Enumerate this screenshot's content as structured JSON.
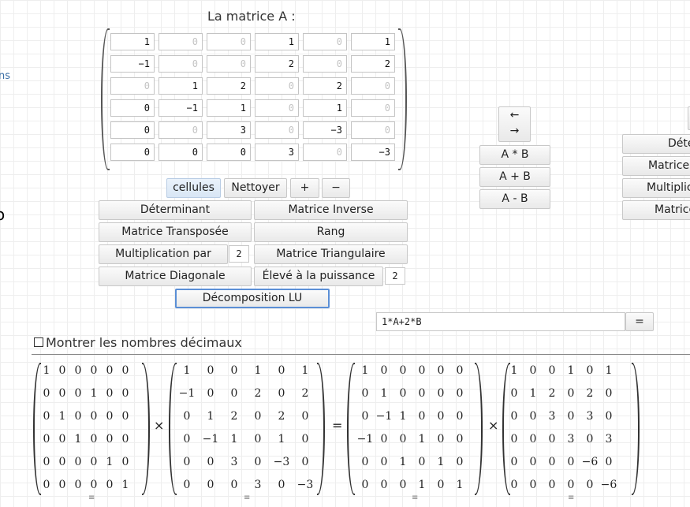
{
  "left_panel": {
    "fragment": "ns",
    "dot": "o"
  },
  "matrix_a": {
    "title": "La matrice A :",
    "rows": [
      [
        "1",
        "0",
        "0",
        "1",
        "0",
        "1"
      ],
      [
        "−1",
        "0",
        "0",
        "2",
        "0",
        "2"
      ],
      [
        "0",
        "1",
        "2",
        "0",
        "2",
        "0"
      ],
      [
        "0",
        "−1",
        "1",
        "0",
        "1",
        "0"
      ],
      [
        "0",
        "0",
        "3",
        "0",
        "−3",
        "0"
      ],
      [
        "0",
        "0",
        "0",
        "3",
        "0",
        "−3"
      ]
    ],
    "zero_flags": [
      [
        false,
        true,
        true,
        false,
        true,
        false
      ],
      [
        false,
        true,
        true,
        false,
        true,
        false
      ],
      [
        true,
        false,
        false,
        true,
        false,
        true
      ],
      [
        false,
        false,
        false,
        true,
        false,
        true
      ],
      [
        false,
        true,
        false,
        true,
        false,
        true
      ],
      [
        false,
        false,
        false,
        false,
        true,
        false
      ]
    ]
  },
  "toolbar": {
    "cells": "cellules",
    "clear": "Nettoyer",
    "plus": "+",
    "minus": "−"
  },
  "ops": {
    "determinant": "Déterminant",
    "inverse": "Matrice Inverse",
    "transpose": "Matrice Transposée",
    "rank": "Rang",
    "multiply_by": "Multiplication par",
    "multiply_value": "2",
    "triangular": "Matrice Triangulaire",
    "diagonal": "Matrice Diagonale",
    "power": "Élevé à la puissance",
    "power_value": "2",
    "lu": "Décomposition LU"
  },
  "swap": {
    "left": "←",
    "right": "→"
  },
  "binary_ops": {
    "mul": "A * B",
    "add": "A + B",
    "sub": "A - B"
  },
  "right_panel": {
    "b1": "Déte",
    "b2": "Matrice ",
    "b3": "Multiplica",
    "b4": "Matrice"
  },
  "formula": {
    "value": "1*A+2*B",
    "eq_button": "="
  },
  "show_decimals": {
    "label": "Montrer les nombres décimaux",
    "checked": false
  },
  "lu_result": {
    "matrices": [
      [
        [
          "1",
          "0",
          "0",
          "0",
          "0",
          "0"
        ],
        [
          "0",
          "0",
          "0",
          "1",
          "0",
          "0"
        ],
        [
          "0",
          "1",
          "0",
          "0",
          "0",
          "0"
        ],
        [
          "0",
          "0",
          "1",
          "0",
          "0",
          "0"
        ],
        [
          "0",
          "0",
          "0",
          "0",
          "1",
          "0"
        ],
        [
          "0",
          "0",
          "0",
          "0",
          "0",
          "1"
        ]
      ],
      [
        [
          "1",
          "0",
          "0",
          "1",
          "0",
          "1"
        ],
        [
          "−1",
          "0",
          "0",
          "2",
          "0",
          "2"
        ],
        [
          "0",
          "1",
          "2",
          "0",
          "2",
          "0"
        ],
        [
          "0",
          "−1",
          "1",
          "0",
          "1",
          "0"
        ],
        [
          "0",
          "0",
          "3",
          "0",
          "−3",
          "0"
        ],
        [
          "0",
          "0",
          "0",
          "3",
          "0",
          "−3"
        ]
      ],
      [
        [
          "1",
          "0",
          "0",
          "0",
          "0",
          "0"
        ],
        [
          "0",
          "1",
          "0",
          "0",
          "0",
          "0"
        ],
        [
          "0",
          "−1",
          "1",
          "0",
          "0",
          "0"
        ],
        [
          "−1",
          "0",
          "0",
          "1",
          "0",
          "0"
        ],
        [
          "0",
          "0",
          "1",
          "0",
          "1",
          "0"
        ],
        [
          "0",
          "0",
          "0",
          "1",
          "0",
          "1"
        ]
      ],
      [
        [
          "1",
          "0",
          "0",
          "1",
          "0",
          "1"
        ],
        [
          "0",
          "1",
          "2",
          "0",
          "2",
          "0"
        ],
        [
          "0",
          "0",
          "3",
          "0",
          "3",
          "0"
        ],
        [
          "0",
          "0",
          "0",
          "3",
          "0",
          "3"
        ],
        [
          "0",
          "0",
          "0",
          "0",
          "−6",
          "0"
        ],
        [
          "0",
          "0",
          "0",
          "0",
          "0",
          "−6"
        ]
      ]
    ],
    "operators": [
      "×",
      "=",
      "×"
    ],
    "menu_icon": "≡"
  }
}
